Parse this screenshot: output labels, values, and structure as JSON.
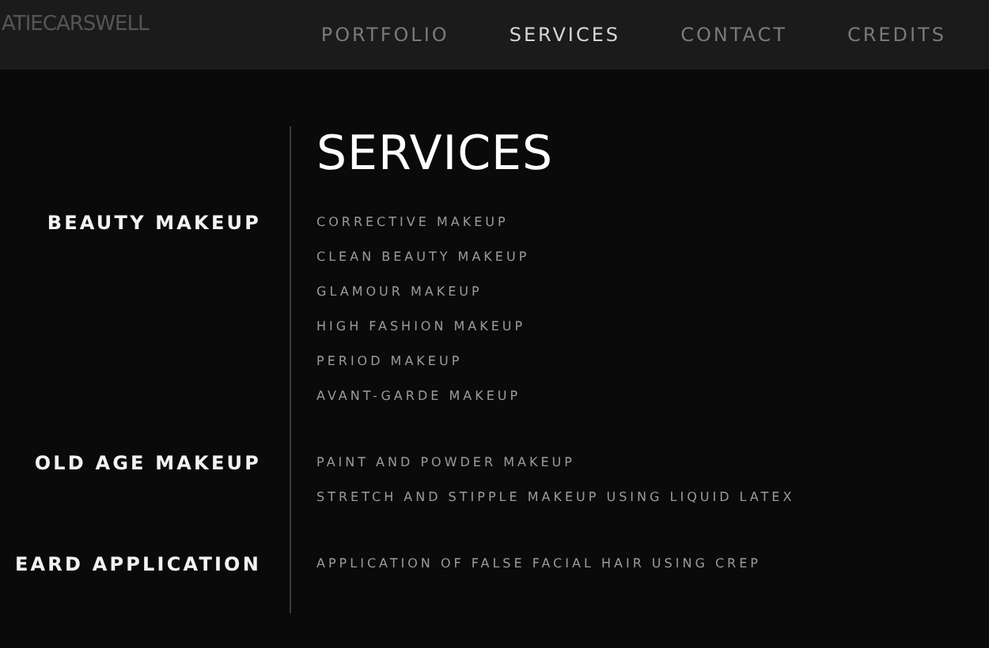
{
  "header": {
    "logo": "ATIECARSWELL",
    "nav": [
      {
        "label": "PORTFOLIO",
        "selected": false
      },
      {
        "label": "SERVICES",
        "selected": true
      },
      {
        "label": "CONTACT",
        "selected": false
      },
      {
        "label": "CREDITS",
        "selected": false
      }
    ]
  },
  "title": "SERVICES",
  "sections": [
    {
      "category": "BEAUTY MAKEUP",
      "items": [
        "CORRECTIVE MAKEUP",
        "CLEAN BEAUTY MAKEUP",
        "GLAMOUR MAKEUP",
        "HIGH FASHION MAKEUP",
        "PERIOD MAKEUP",
        "AVANT-GARDE MAKEUP"
      ]
    },
    {
      "category": "OLD AGE MAKEUP",
      "items": [
        "PAINT AND POWDER MAKEUP",
        "STRETCH AND STIPPLE MAKEUP USING LIQUID LATEX"
      ]
    },
    {
      "category": "EARD APPLICATION",
      "items": [
        "APPLICATION OF FALSE FACIAL HAIR USING CREP"
      ]
    }
  ]
}
